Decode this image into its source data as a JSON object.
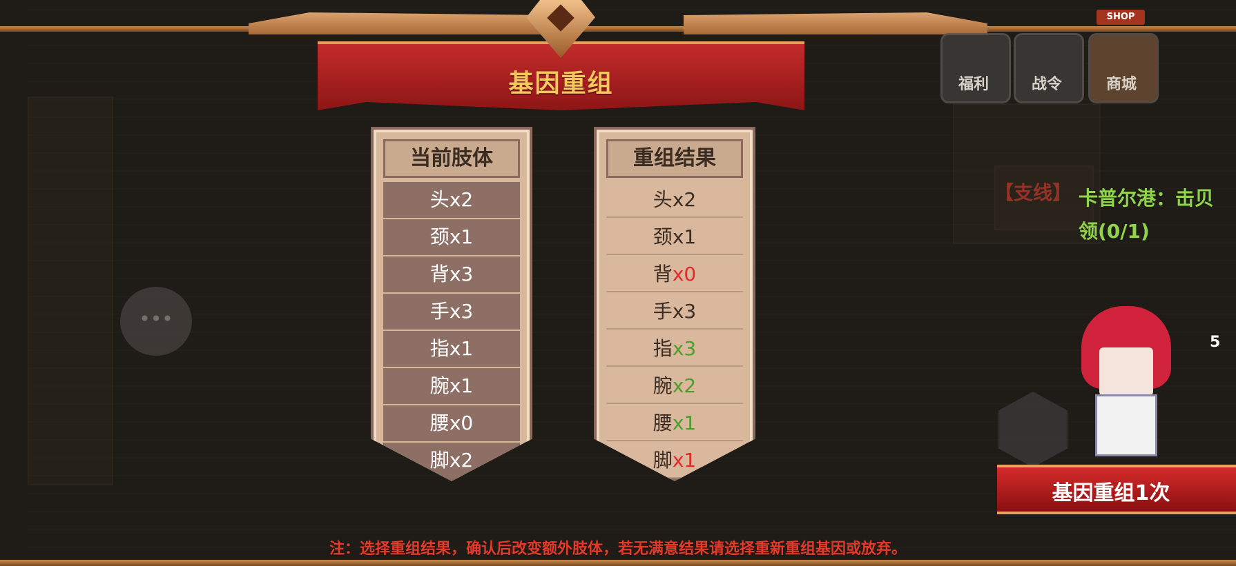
{
  "dialog": {
    "title": "基因重组",
    "note": "注：选择重组结果，确认后改变额外肢体，若无满意结果请选择重新重组基因或放弃。"
  },
  "current_panel": {
    "header": "当前肢体",
    "rows": [
      {
        "label": "头",
        "value": "x2",
        "value_color": "#ffffff"
      },
      {
        "label": "颈",
        "value": "x1",
        "value_color": "#ffffff"
      },
      {
        "label": "背",
        "value": "x3",
        "value_color": "#ffffff"
      },
      {
        "label": "手",
        "value": "x3",
        "value_color": "#ffffff"
      },
      {
        "label": "指",
        "value": "x1",
        "value_color": "#ffffff"
      },
      {
        "label": "腕",
        "value": "x1",
        "value_color": "#ffffff"
      },
      {
        "label": "腰",
        "value": "x0",
        "value_color": "#ffffff"
      },
      {
        "label": "脚",
        "value": "x2",
        "value_color": "#ffffff"
      }
    ]
  },
  "result_panel": {
    "header": "重组结果",
    "rows": [
      {
        "label": "头",
        "value": "x2",
        "value_color": "#3b2c22"
      },
      {
        "label": "颈",
        "value": "x1",
        "value_color": "#3b2c22"
      },
      {
        "label": "背",
        "value": "x0",
        "value_color": "#e02a2a"
      },
      {
        "label": "手",
        "value": "x3",
        "value_color": "#3b2c22"
      },
      {
        "label": "指",
        "value": "x3",
        "value_color": "#4aa02a"
      },
      {
        "label": "腕",
        "value": "x2",
        "value_color": "#4aa02a"
      },
      {
        "label": "腰",
        "value": "x1",
        "value_color": "#4aa02a"
      },
      {
        "label": "脚",
        "value": "x1",
        "value_color": "#e02a2a"
      }
    ]
  },
  "hud": {
    "welfare_label": "福利",
    "battle_pass_label": "战令",
    "shop_label": "商城",
    "shop_sign": "SHOP",
    "quest_tag": "【支线】",
    "quest_title": "卡普尔港：击贝",
    "quest_progress": "领(0/1)",
    "item_count": "5",
    "recombine_button": "基因重组1次"
  },
  "colors": {
    "banner_red": "#b52020",
    "title_gold": "#f4c85c",
    "note_red": "#e23b2b",
    "increase_green": "#4aa02a",
    "decrease_red": "#e02a2a"
  }
}
